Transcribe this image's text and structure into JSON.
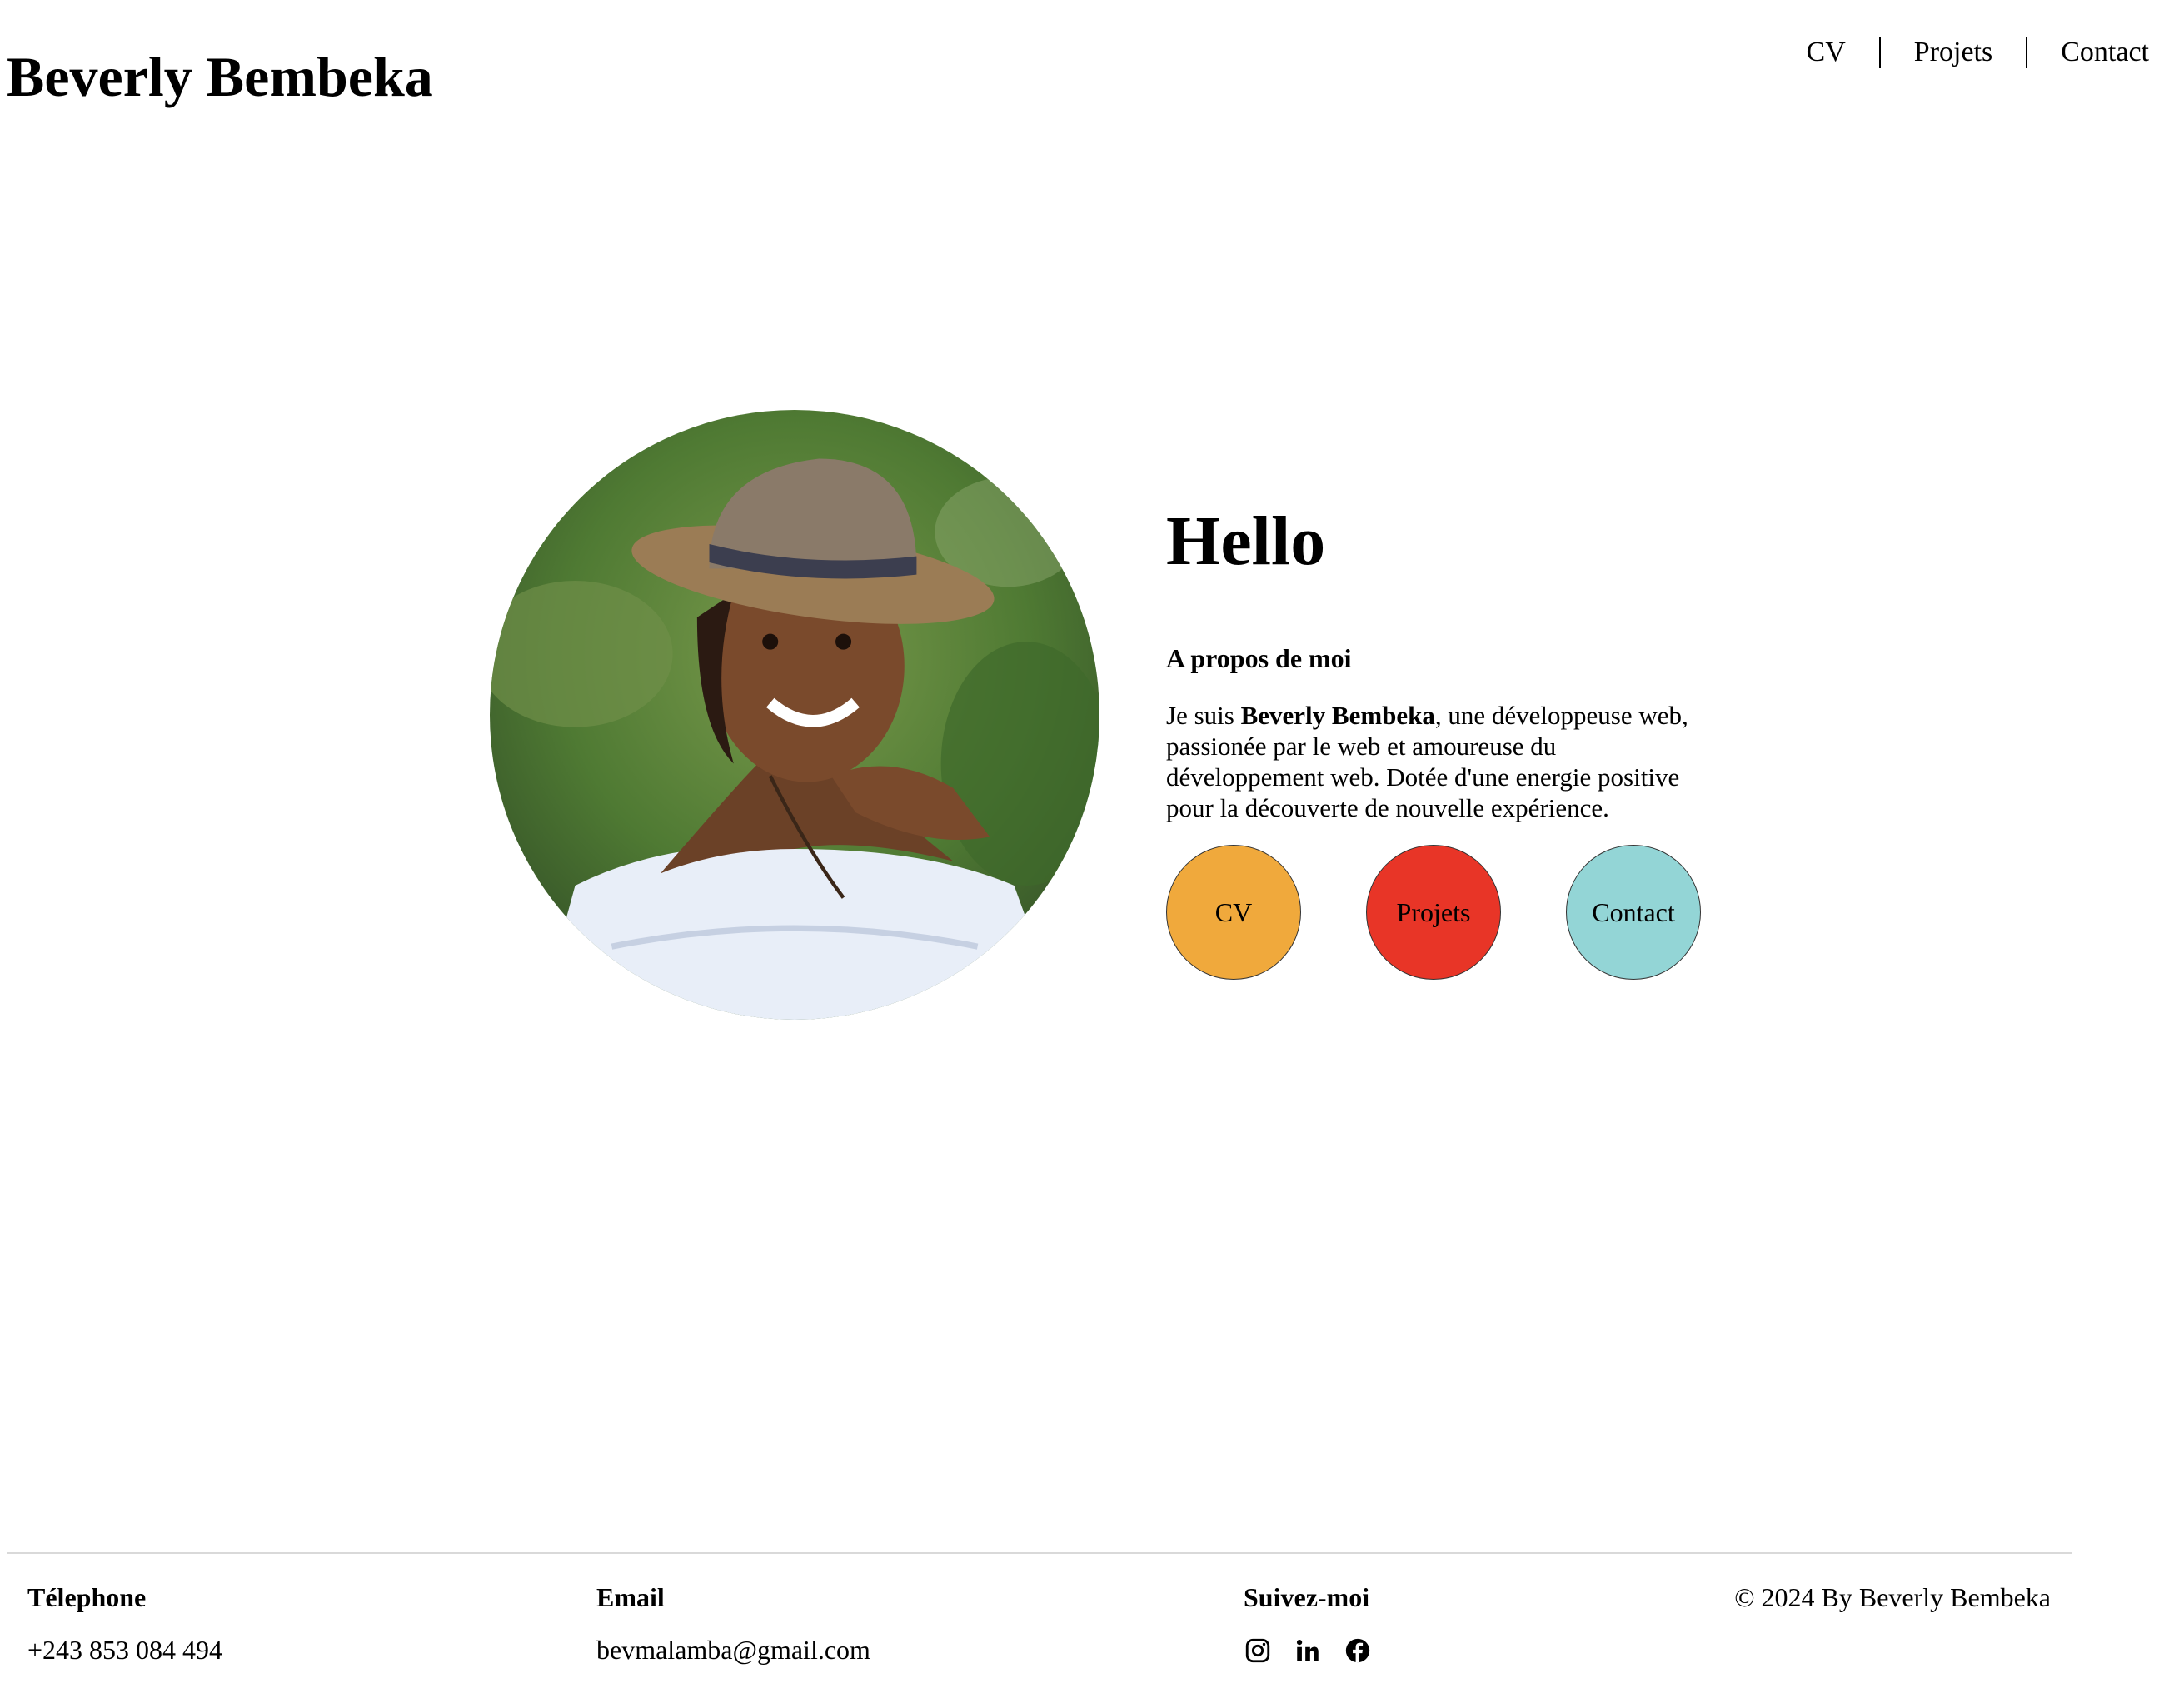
{
  "header": {
    "title": "Beverly Bembeka",
    "nav": [
      "CV",
      "Projets",
      "Contact"
    ]
  },
  "hero": {
    "photo_alt": "Beverly Bembeka",
    "greeting": "Hello",
    "about_heading": "A propos de moi",
    "about_prefix": "Je suis ",
    "about_name": "Beverly Bembeka",
    "about_suffix": ", une développeuse web, passionée par le web et amoureuse du développement web. Dotée d'une energie positive pour la découverte de nouvelle expérience.",
    "buttons": [
      {
        "label": "CV",
        "color": "#f0a93c"
      },
      {
        "label": "Projets",
        "color": "#e83527"
      },
      {
        "label": "Contact",
        "color": "#93d5d6"
      }
    ]
  },
  "footer": {
    "phone_heading": "Télephone",
    "phone": "+243 853 084 494",
    "email_heading": "Email",
    "email": "bevmalamba@gmail.com",
    "social_heading": "Suivez-moi",
    "social_icons": [
      "instagram-icon",
      "linkedin-icon",
      "facebook-icon"
    ],
    "copyright": "© 2024 By Beverly Bembeka"
  }
}
